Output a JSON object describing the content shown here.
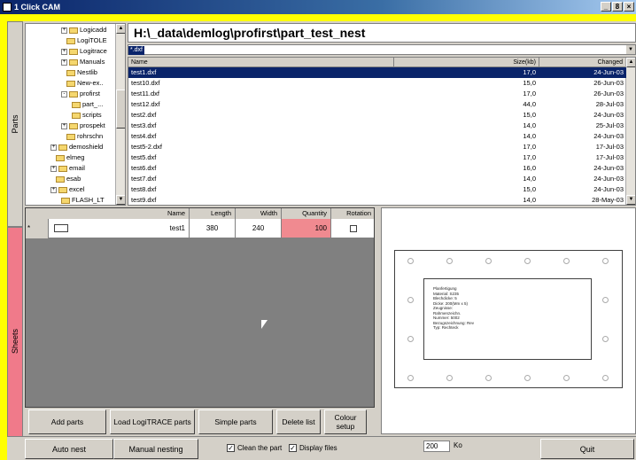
{
  "window": {
    "title": "1 Click CAM",
    "buttons": [
      "_",
      "8",
      "×"
    ]
  },
  "tabs": {
    "parts": "Parts",
    "sheets": "Sheets"
  },
  "tree": {
    "items": [
      {
        "label": "Logicadd",
        "pm": "+"
      },
      {
        "label": "LogiTOLE",
        "pm": ""
      },
      {
        "label": "Logitrace",
        "pm": "+"
      },
      {
        "label": "Manuals",
        "pm": "+"
      },
      {
        "label": "Nestlib",
        "pm": ""
      },
      {
        "label": "New-ex..",
        "pm": ""
      },
      {
        "label": "profirst",
        "pm": "-"
      },
      {
        "label": "part_...",
        "pm": ""
      },
      {
        "label": "scripts",
        "pm": ""
      },
      {
        "label": "prospekt",
        "pm": "+"
      },
      {
        "label": "rohrschn",
        "pm": ""
      },
      {
        "label": "demoshield",
        "pm": "+"
      },
      {
        "label": "elmeg",
        "pm": ""
      },
      {
        "label": "email",
        "pm": "+"
      },
      {
        "label": "esab",
        "pm": ""
      },
      {
        "label": "excel",
        "pm": "+"
      },
      {
        "label": "FLASH_LT",
        "pm": ""
      }
    ]
  },
  "path": "H:\\_data\\demlog\\profirst\\part_test_nest",
  "filter": {
    "value": "*.dxf"
  },
  "filelist": {
    "headers": {
      "name": "Name",
      "size": "Size(kb)",
      "changed": "Changed"
    },
    "rows": [
      {
        "name": "test1.dxf",
        "size": "17,0",
        "changed": "24-Jun-03"
      },
      {
        "name": "test10.dxf",
        "size": "15,0",
        "changed": "26-Jun-03"
      },
      {
        "name": "test11.dxf",
        "size": "17,0",
        "changed": "26-Jun-03"
      },
      {
        "name": "test12.dxf",
        "size": "44,0",
        "changed": "28-Jul-03"
      },
      {
        "name": "test2.dxf",
        "size": "15,0",
        "changed": "24-Jun-03"
      },
      {
        "name": "test3.dxf",
        "size": "14,0",
        "changed": "25-Jul-03"
      },
      {
        "name": "test4.dxf",
        "size": "14,0",
        "changed": "24-Jun-03"
      },
      {
        "name": "test5-2.dxf",
        "size": "17,0",
        "changed": "17-Jul-03"
      },
      {
        "name": "test5.dxf",
        "size": "17,0",
        "changed": "17-Jul-03"
      },
      {
        "name": "test6.dxf",
        "size": "16,0",
        "changed": "24-Jun-03"
      },
      {
        "name": "test7.dxf",
        "size": "14,0",
        "changed": "24-Jun-03"
      },
      {
        "name": "test8.dxf",
        "size": "15,0",
        "changed": "24-Jun-03"
      },
      {
        "name": "test9.dxf",
        "size": "14,0",
        "changed": "28-May-03"
      }
    ]
  },
  "sheets": {
    "headers": {
      "name": "Name",
      "length": "Length",
      "width": "Width",
      "quantity": "Quantity",
      "rotation": "Rotation"
    },
    "rows": [
      {
        "marker": "*",
        "name": "test1",
        "length": "380",
        "width": "240",
        "quantity": "100"
      }
    ]
  },
  "preview": {
    "notes": [
      "Planfertigung",
      "Material: S235",
      "Blechdicke: 5",
      "Dicke: 200(Mm x 5)",
      "Zeugnisse:",
      "Rahmenzeichn.",
      "Nummer: 5002",
      "Bezugszeichnung: Rev",
      "Typ: Rechteck"
    ]
  },
  "buttons": {
    "add_parts": "Add parts",
    "load_logitrace": "Load LogiTRACE parts",
    "simple_parts": "Simple parts",
    "delete_list": "Delete list",
    "colour_setup": "Colour setup"
  },
  "bottom": {
    "auto_nest": "Auto nest",
    "manual_nesting": "Manual nesting",
    "clean_part": "Clean the part",
    "display_files": "Display files",
    "value": "200",
    "unit": "Ko",
    "quit": "Quit"
  }
}
